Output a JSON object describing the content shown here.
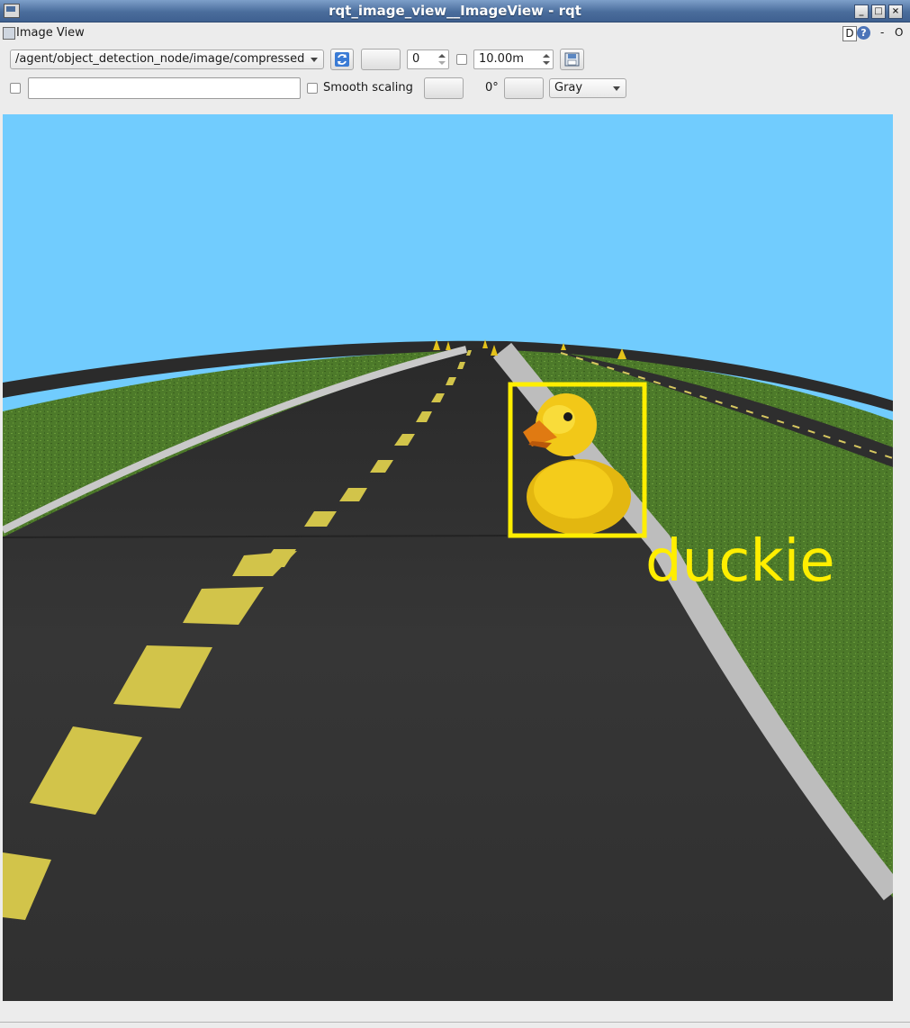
{
  "window": {
    "title": "rqt_image_view__ImageView - rqt",
    "buttons": [
      "minimize",
      "maximize",
      "close"
    ]
  },
  "dock": {
    "title": "Image View",
    "d_label": "D",
    "help_label": "?",
    "close_label": "-",
    "float_label": "O"
  },
  "toolbar": {
    "topic": "/agent/object_detection_node/image/compressed",
    "frame_count": "0",
    "timeout": "10.00m",
    "smooth_scaling_label": "Smooth scaling",
    "rotation": "0°",
    "color_scheme": "Gray"
  },
  "image": {
    "detection_label": "duckie",
    "box_color": "#ffee00",
    "sky_color": "#71ccfe",
    "road_color": "#333333",
    "grass_color": "#4d7a2a",
    "lane_marking_color": "#d2c44a"
  }
}
